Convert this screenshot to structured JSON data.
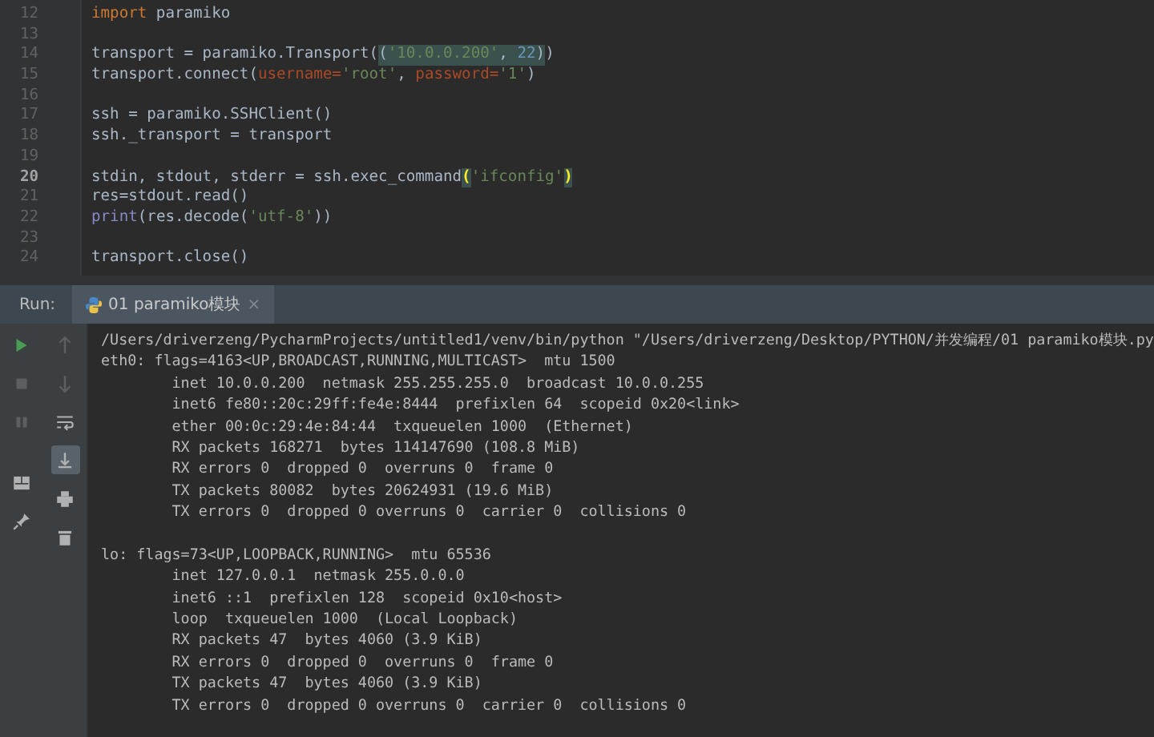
{
  "editor": {
    "lines": [
      {
        "number": "12",
        "current": false,
        "tokens": [
          {
            "text": "import",
            "kind": "keyword",
            "matched": false
          },
          {
            "text": " paramiko",
            "kind": "plain",
            "matched": false
          }
        ]
      },
      {
        "number": "13",
        "current": false
      },
      {
        "number": "14",
        "current": false,
        "tokens": [
          {
            "text": "transport = paramiko.Transport(",
            "kind": "plain",
            "matched": false
          },
          {
            "text": "(",
            "kind": "plain",
            "matched": true
          },
          {
            "text": "'10.0.0.200'",
            "kind": "string",
            "matched": true
          },
          {
            "text": ", ",
            "kind": "plain",
            "matched": true
          },
          {
            "text": "22",
            "kind": "number",
            "matched": true
          },
          {
            "text": ")",
            "kind": "plain",
            "matched": true
          },
          {
            "text": ")",
            "kind": "plain",
            "matched": false
          }
        ]
      },
      {
        "number": "15",
        "current": false,
        "tokens": [
          {
            "text": "transport.connect(",
            "kind": "plain",
            "matched": false
          },
          {
            "text": "username=",
            "kind": "argument",
            "matched": false
          },
          {
            "text": "'root'",
            "kind": "string",
            "matched": false
          },
          {
            "text": ", ",
            "kind": "plain",
            "matched": false
          },
          {
            "text": "password=",
            "kind": "argument",
            "matched": false
          },
          {
            "text": "'1'",
            "kind": "string",
            "matched": false
          },
          {
            "text": ")",
            "kind": "plain",
            "matched": false
          }
        ]
      },
      {
        "number": "16",
        "current": false
      },
      {
        "number": "17",
        "current": false,
        "tokens": [
          {
            "text": "ssh = paramiko.SSHClient()",
            "kind": "plain",
            "matched": false
          }
        ]
      },
      {
        "number": "18",
        "current": false,
        "tokens": [
          {
            "text": "ssh._transport = transport",
            "kind": "plain",
            "matched": false
          }
        ]
      },
      {
        "number": "19",
        "current": false
      },
      {
        "number": "20",
        "current": true,
        "tokens": [
          {
            "text": "stdin, stdout, stderr = ssh.exec_command",
            "kind": "plain",
            "matched": false
          },
          {
            "text": "(",
            "kind": "brace",
            "matched": true
          },
          {
            "text": "'ifconfig'",
            "kind": "string",
            "matched": false
          },
          {
            "text": ")",
            "kind": "brace",
            "matched": true
          }
        ]
      },
      {
        "number": "21",
        "current": false,
        "tokens": [
          {
            "text": "res=stdout.read()",
            "kind": "plain",
            "matched": false
          }
        ]
      },
      {
        "number": "22",
        "current": false,
        "tokens": [
          {
            "text": "print",
            "kind": "builtin",
            "matched": false
          },
          {
            "text": "(res.decode(",
            "kind": "plain",
            "matched": false
          },
          {
            "text": "'utf-8'",
            "kind": "string",
            "matched": false
          },
          {
            "text": "))",
            "kind": "plain",
            "matched": false
          }
        ]
      },
      {
        "number": "23",
        "current": false
      },
      {
        "number": "24",
        "current": false,
        "tokens": [
          {
            "text": "transport.close()",
            "kind": "plain",
            "matched": false
          }
        ]
      }
    ]
  },
  "run_panel": {
    "label": "Run:",
    "tab": {
      "title": "01 paramiko模块",
      "close": "×"
    },
    "actions": [
      {
        "kind": "rerun",
        "disabled": false,
        "on": false
      },
      {
        "kind": "stop",
        "disabled": true,
        "on": false
      },
      {
        "kind": "pause",
        "disabled": true,
        "on": false
      },
      {
        "kind": "layout",
        "disabled": false,
        "on": false
      },
      {
        "kind": "pin",
        "disabled": false,
        "on": false
      }
    ],
    "navigation": [
      {
        "kind": "up",
        "disabled": true,
        "on": false
      },
      {
        "kind": "down",
        "disabled": true,
        "on": false
      },
      {
        "kind": "wrap",
        "disabled": false,
        "on": false
      },
      {
        "kind": "scroll-end",
        "disabled": false,
        "on": true
      },
      {
        "kind": "print",
        "disabled": false,
        "on": false
      },
      {
        "kind": "trash",
        "disabled": false,
        "on": false
      }
    ],
    "output_blocks": [
      [
        "/Users/driverzeng/PycharmProjects/untitled1/venv/bin/python \"/Users/driverzeng/Desktop/PYTHON/并发编程/01 paramiko模块.py",
        "eth0: flags=4163<UP,BROADCAST,RUNNING,MULTICAST>  mtu 1500",
        "        inet 10.0.0.200  netmask 255.255.255.0  broadcast 10.0.0.255",
        "        inet6 fe80::20c:29ff:fe4e:8444  prefixlen 64  scopeid 0x20<link>",
        "        ether 00:0c:29:4e:84:44  txqueuelen 1000  (Ethernet)",
        "        RX packets 168271  bytes 114147690 (108.8 MiB)",
        "        RX errors 0  dropped 0  overruns 0  frame 0",
        "        TX packets 80082  bytes 20624931 (19.6 MiB)",
        "        TX errors 0  dropped 0 overruns 0  carrier 0  collisions 0"
      ],
      [
        "lo: flags=73<UP,LOOPBACK,RUNNING>  mtu 65536",
        "        inet 127.0.0.1  netmask 255.0.0.0",
        "        inet6 ::1  prefixlen 128  scopeid 0x10<host>",
        "        loop  txqueuelen 1000  (Local Loopback)",
        "        RX packets 47  bytes 4060 (3.9 KiB)",
        "        RX errors 0  dropped 0  overruns 0  frame 0",
        "        TX packets 47  bytes 4060 (3.9 KiB)",
        "        TX errors 0  dropped 0 overruns 0  carrier 0  collisions 0"
      ]
    ]
  }
}
